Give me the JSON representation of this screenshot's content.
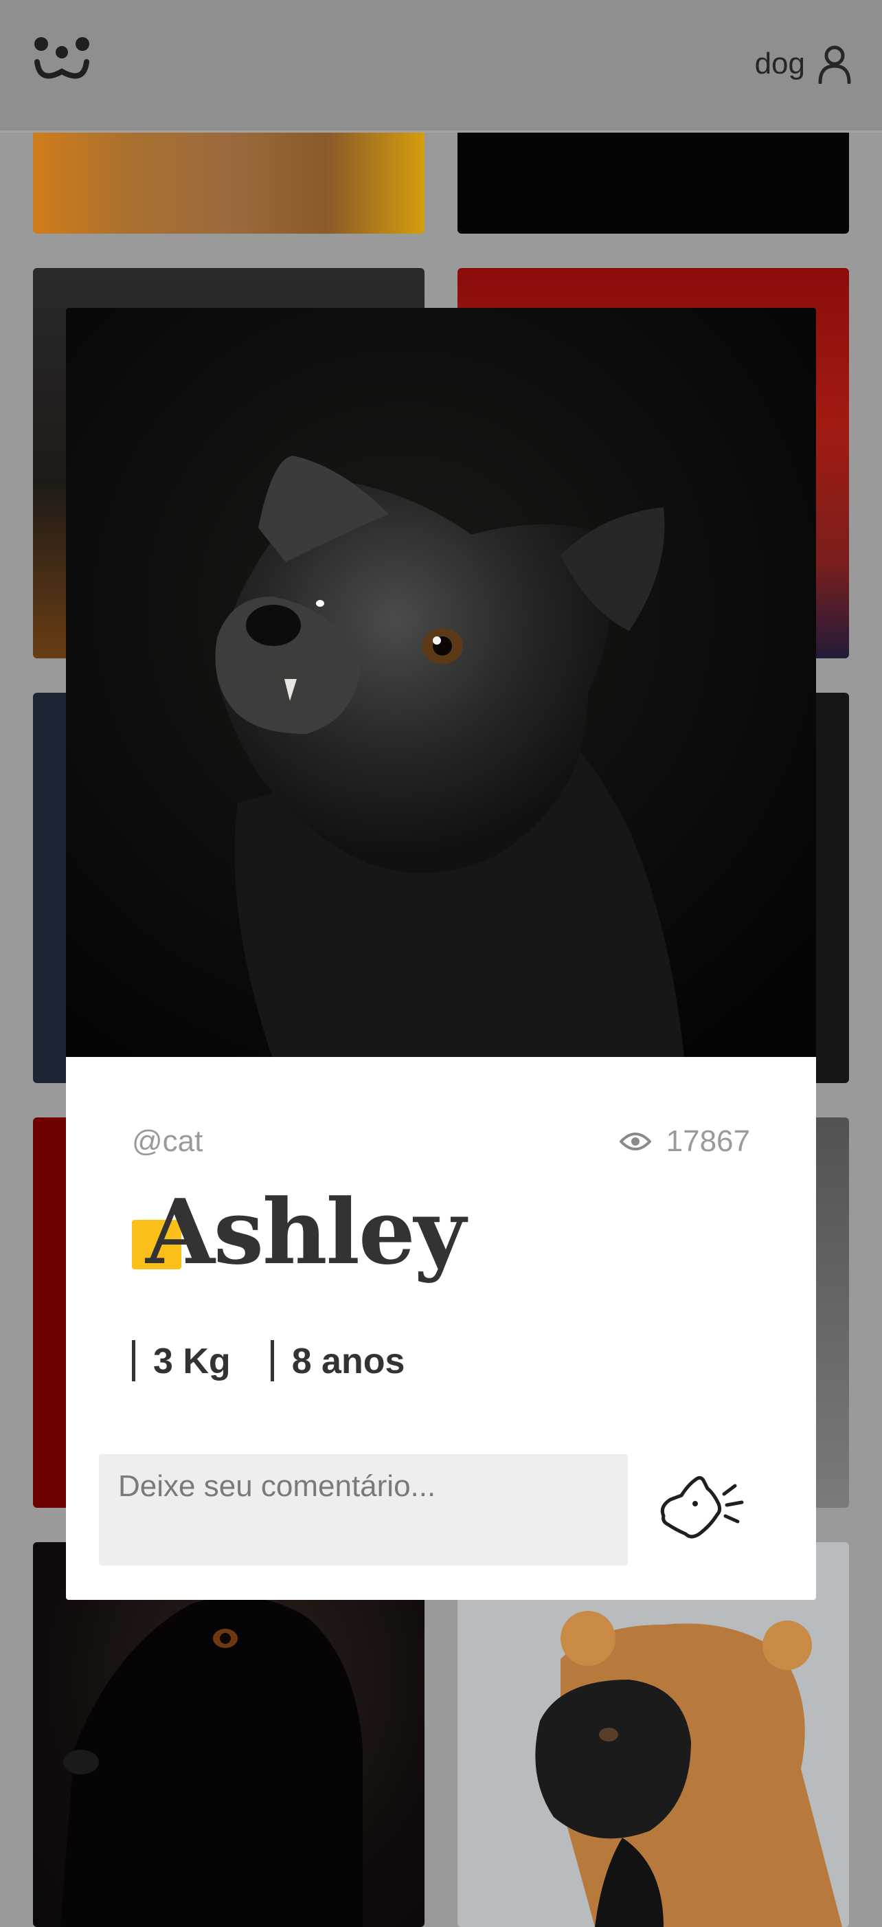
{
  "header": {
    "logo_icon": "dog-face-logo-icon",
    "username": "dog",
    "user_icon": "user-icon"
  },
  "photo": {
    "author": "@cat",
    "views_icon": "eye-icon",
    "views": "17867",
    "name": "Ashley",
    "weight": "3 Kg",
    "age": "8 anos"
  },
  "comment": {
    "placeholder": "Deixe seu comentário...",
    "send_icon": "barking-dog-send-icon"
  },
  "colors": {
    "accent": "#fbbf1a",
    "text": "#333333",
    "muted": "#9a9a9a",
    "input_bg": "#eeeeee"
  }
}
